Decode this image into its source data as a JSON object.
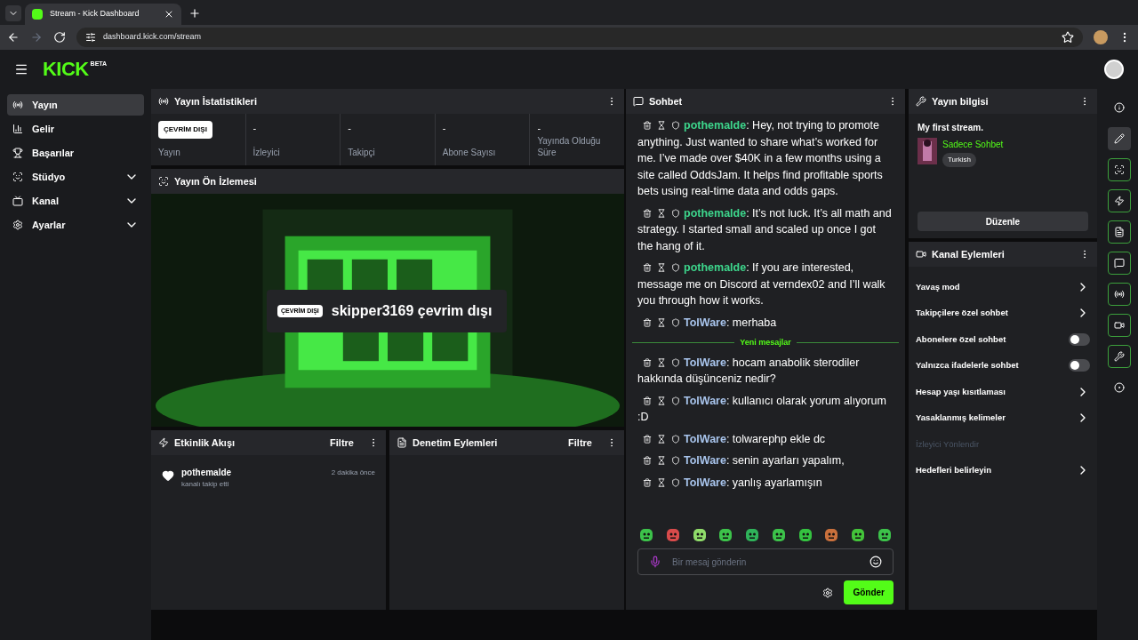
{
  "browser": {
    "tab_title": "Stream - Kick Dashboard",
    "url": "dashboard.kick.com/stream"
  },
  "header": {
    "logo": "KICK",
    "logo_badge": "BETA"
  },
  "sidebar": {
    "items": [
      {
        "label": "Yayın",
        "selected": true,
        "kind": "link"
      },
      {
        "label": "Gelir",
        "selected": false,
        "kind": "link"
      },
      {
        "label": "Başarılar",
        "selected": false,
        "kind": "link"
      },
      {
        "label": "Stüdyo",
        "selected": false,
        "kind": "group",
        "expanded": false
      },
      {
        "label": "Kanal",
        "selected": false,
        "kind": "group",
        "expanded": false
      },
      {
        "label": "Ayarlar",
        "selected": false,
        "kind": "group",
        "expanded": false
      }
    ]
  },
  "stats": {
    "title": "Yayın İstatistikleri",
    "status_badge": "ÇEVRİM DIŞI",
    "cells": [
      {
        "label": "Yayın",
        "kind": "status"
      },
      {
        "value": "-",
        "label": "İzleyici",
        "kind": "value"
      },
      {
        "value": "-",
        "label": "Takipçi",
        "kind": "value"
      },
      {
        "value": "-",
        "label": "Abone Sayısı",
        "kind": "value"
      },
      {
        "value": "-",
        "label": "Yayında Olduğu Süre",
        "kind": "value"
      }
    ]
  },
  "preview": {
    "title": "Yayın Ön İzlemesi",
    "kind": "picture",
    "overlay_badge": "ÇEVRİM DIŞI",
    "overlay_text": "skipper3169 çevrim dışı"
  },
  "activity": {
    "title": "Etkinlik Akışı",
    "filter": "Filtre",
    "events": [
      {
        "user": "pothemalde",
        "action": "kanalı takip etti",
        "time": "2 dakika önce"
      }
    ]
  },
  "moderation": {
    "title": "Denetim Eylemleri",
    "filter": "Filtre"
  },
  "chat": {
    "title": "Sohbet",
    "messages": [
      {
        "kind": "message",
        "user": "pothemalde",
        "color": "#3dd68c",
        "text": ": Hey, not trying to promote anything. Just wanted to share what’s worked for me. I’ve made over $40K in a few months using a site called OddsJam. It helps find profitable sports bets using real-time data and odds gaps."
      },
      {
        "kind": "message",
        "user": "pothemalde",
        "color": "#3dd68c",
        "text": ": It’s not luck. It’s all math and strategy. I started small and scaled up once I got the hang of it."
      },
      {
        "kind": "message",
        "user": "pothemalde",
        "color": "#3dd68c",
        "text": ": If you are interested, message me on Discord at verndex02 and I’ll walk you through how it works."
      },
      {
        "kind": "message",
        "user": "TolWare",
        "color": "#a8c4ec",
        "text": ": merhaba"
      },
      {
        "kind": "divider",
        "text": "Yeni mesajlar"
      },
      {
        "kind": "message",
        "user": "TolWare",
        "color": "#a8c4ec",
        "text": ": hocam anabolik sterodiler hakkında düşünceniz nedir?"
      },
      {
        "kind": "message",
        "user": "TolWare",
        "color": "#a8c4ec",
        "text": ": kullanıcı olarak yorum alıyorum :D"
      },
      {
        "kind": "message",
        "user": "TolWare",
        "color": "#a8c4ec",
        "text": ": tolwarephp ekle dc"
      },
      {
        "kind": "message",
        "user": "TolWare",
        "color": "#a8c4ec",
        "text": ": senin ayarları yapalım,"
      },
      {
        "kind": "message",
        "user": "TolWare",
        "color": "#a8c4ec",
        "text": ": yanlış ayarlamışın"
      }
    ],
    "emotes": [
      {
        "color": "#3cc24a"
      },
      {
        "color": "#d94b4b"
      },
      {
        "color": "#8fdc6a"
      },
      {
        "color": "#3cc24a"
      },
      {
        "color": "#2fb35a"
      },
      {
        "color": "#3cc24a"
      },
      {
        "color": "#34c240"
      },
      {
        "color": "#c9703c"
      },
      {
        "color": "#43c43a"
      },
      {
        "color": "#3cc24a"
      }
    ],
    "placeholder": "Bir mesaj gönderin",
    "send": "Gönder"
  },
  "stream_info": {
    "title": "Yayın bilgisi",
    "stream_title": "My first stream.",
    "category": "Sadece Sohbet",
    "tag": "Turkish",
    "edit": "Düzenle"
  },
  "channel_actions": {
    "title": "Kanal Eylemleri",
    "items": [
      {
        "label": "Yavaş mod",
        "kind": "link",
        "disabled": false
      },
      {
        "label": "Takipçilere özel sohbet",
        "kind": "link",
        "disabled": false
      },
      {
        "label": "Abonelere özel sohbet",
        "kind": "toggle",
        "on": false,
        "disabled": false
      },
      {
        "label": "Yalnızca ifadelerle sohbet",
        "kind": "toggle",
        "on": false,
        "disabled": false
      },
      {
        "label": "Hesap yaşı kısıtlaması",
        "kind": "link",
        "disabled": false
      },
      {
        "label": "Yasaklanmış kelimeler",
        "kind": "link",
        "disabled": false
      },
      {
        "label": "İzleyici Yönlendir",
        "kind": "plain",
        "disabled": true
      },
      {
        "label": "Hedefleri belirleyin",
        "kind": "link",
        "disabled": false
      }
    ]
  },
  "rail": [
    {
      "kind": "plain",
      "selected": false
    },
    {
      "kind": "plain",
      "selected": true
    },
    {
      "kind": "outlined",
      "selected": false
    },
    {
      "kind": "outlined",
      "selected": false
    },
    {
      "kind": "outlined",
      "selected": false
    },
    {
      "kind": "outlined",
      "selected": false
    },
    {
      "kind": "outlined",
      "selected": false
    },
    {
      "kind": "outlined",
      "selected": false
    },
    {
      "kind": "outlined",
      "selected": false
    },
    {
      "kind": "plain",
      "selected": false
    }
  ]
}
